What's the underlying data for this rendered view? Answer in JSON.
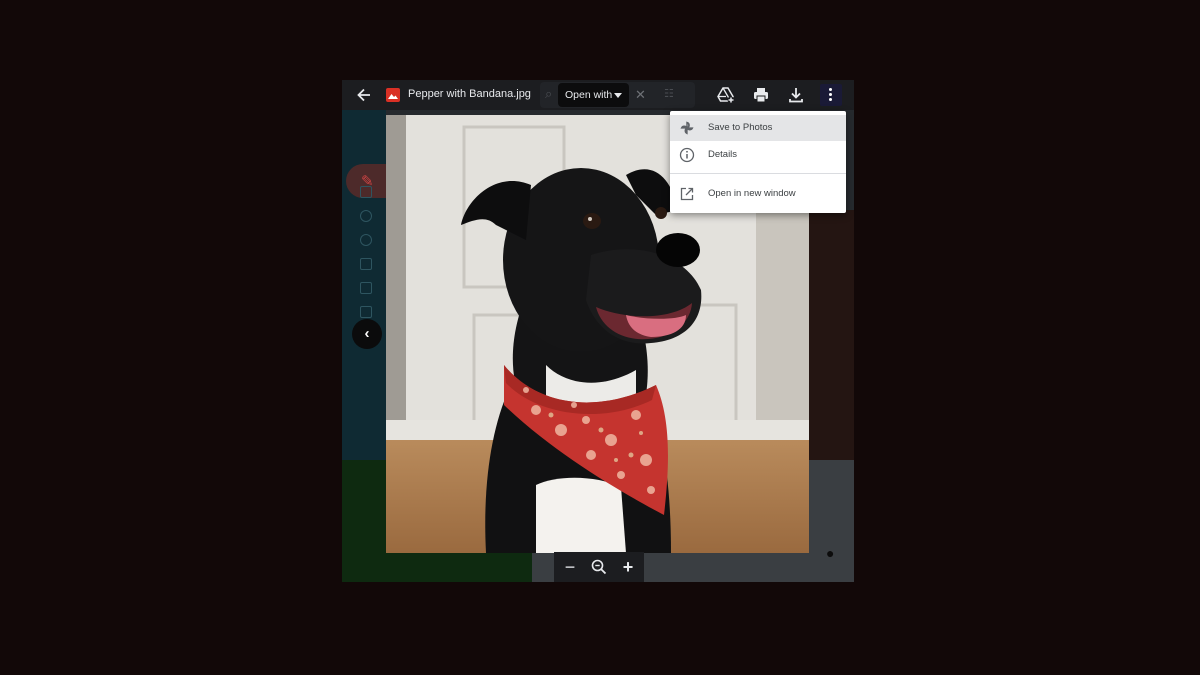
{
  "toolbar": {
    "file_name": "Pepper with Bandana.jpg",
    "open_with_label": "Open with"
  },
  "menu": {
    "items": [
      {
        "label": "Save to Photos",
        "icon": "photos-pinwheel-icon"
      },
      {
        "label": "Details",
        "icon": "info-icon"
      },
      {
        "label": "Open in new window",
        "icon": "open-in-new-icon"
      }
    ]
  },
  "zoom": {
    "out_icon": "minus-icon",
    "reset_icon": "zoom-icon",
    "in_icon": "plus-icon"
  },
  "colors": {
    "backdrop": "#120808",
    "toolbar": "#1c1d20",
    "file_icon": "#d93025",
    "menu_bg": "#ffffff",
    "menu_highlight": "#e4e5e7"
  }
}
